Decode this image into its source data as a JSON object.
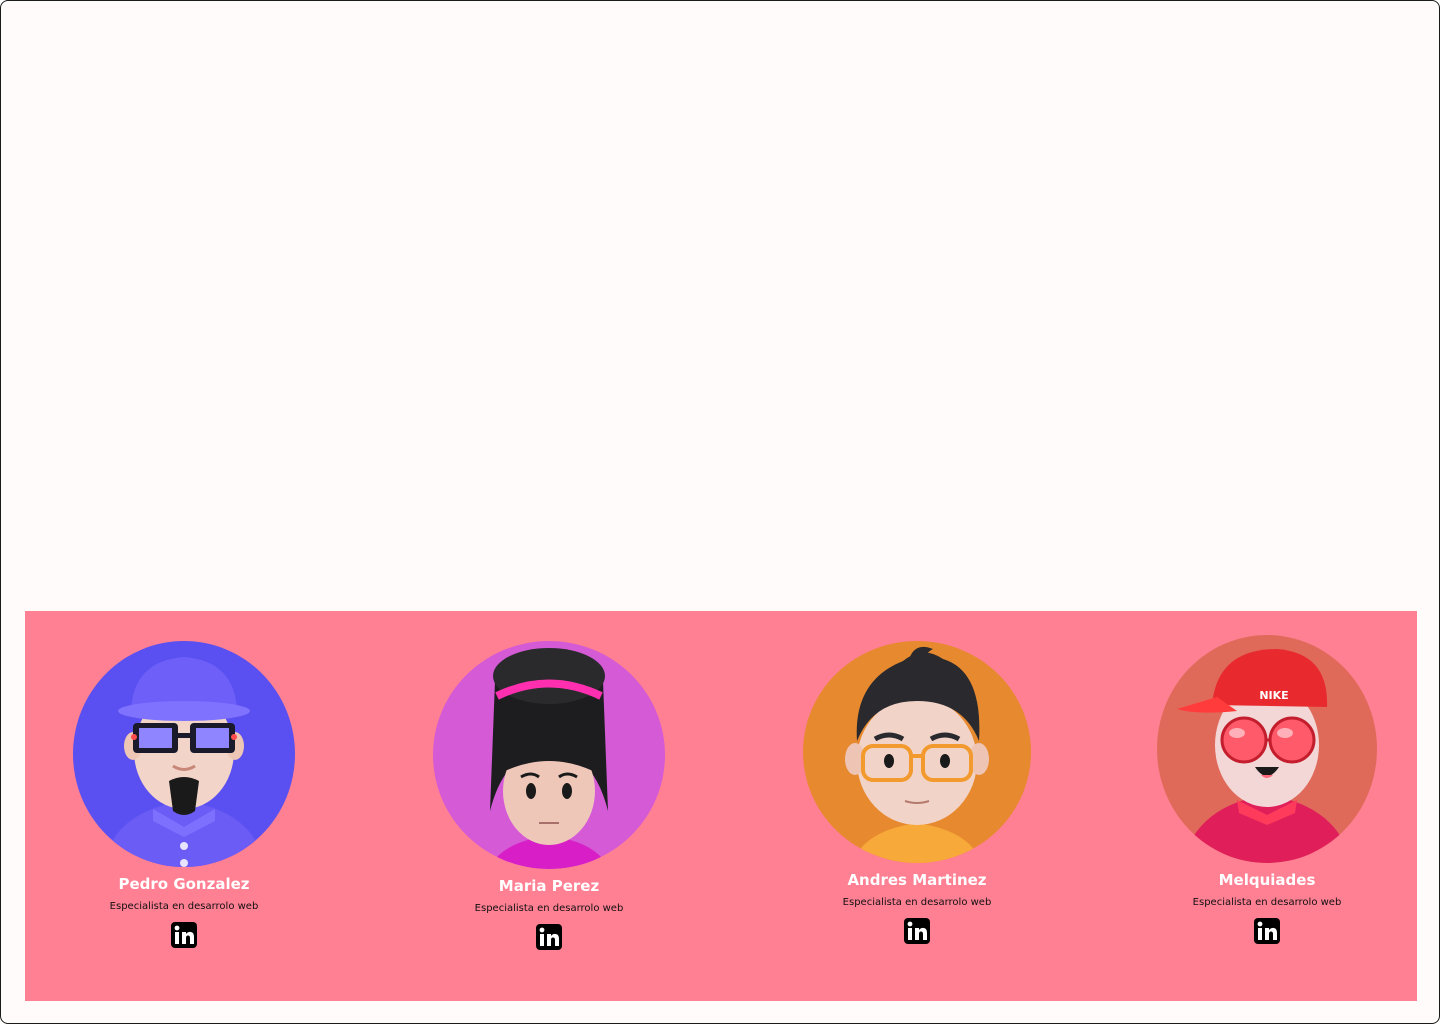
{
  "colors": {
    "page_bg": "#fffbfa",
    "band_bg": "#ff7f93",
    "name_color": "#ffffff",
    "role_color": "#111111"
  },
  "team": {
    "members": [
      {
        "name": "Pedro Gonzalez",
        "role": "Especialista en desarrolo web",
        "avatar_bg": "#5a4ff0",
        "icon": "linkedin-icon"
      },
      {
        "name": "Maria Perez",
        "role": "Especialista en desarrolo web",
        "avatar_bg": "#d45ad6",
        "icon": "linkedin-icon"
      },
      {
        "name": "Andres Martinez",
        "role": "Especialista en desarrolo web",
        "avatar_bg": "#e7892e",
        "icon": "linkedin-icon"
      },
      {
        "name": "Melquiades",
        "role": "Especialista en desarrolo web",
        "avatar_bg": "#e06a5a",
        "icon": "linkedin-icon",
        "cap_text": "NIKE"
      }
    ]
  }
}
